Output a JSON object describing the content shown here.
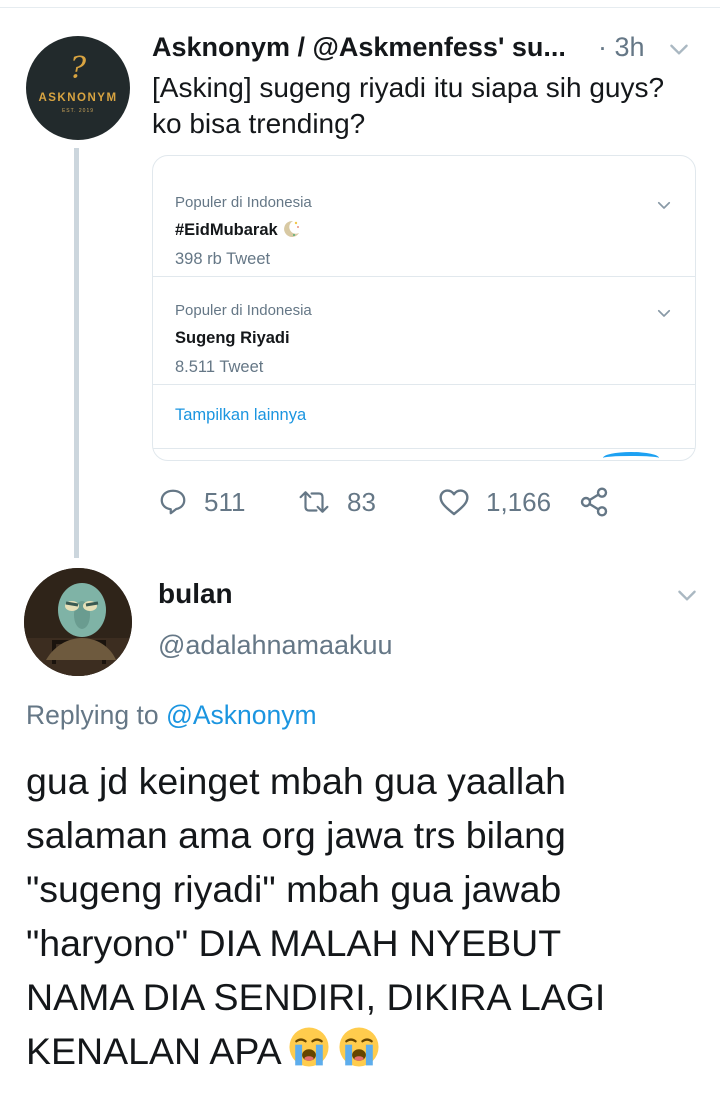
{
  "parent_tweet": {
    "avatar": {
      "brand": "ASKNONYM",
      "est": "EST. 2019",
      "mark": "?"
    },
    "display_name": "Asknonym / @Askmenfess' su...",
    "time": "· 3h",
    "text_lines": [
      "[Asking] sugeng riyadi itu siapa sih guys?",
      "ko bisa trending?"
    ],
    "card": {
      "trends": [
        {
          "location": "Populer di Indonesia",
          "name": "#EidMubarak",
          "emoji": "crescent-moon-emoji",
          "count": "398 rb Tweet"
        },
        {
          "location": "Populer di Indonesia",
          "name": "Sugeng Riyadi",
          "count": "8.511 Tweet"
        }
      ],
      "show_more": "Tampilkan lainnya"
    },
    "actions": {
      "replies": "511",
      "retweets": "83",
      "likes": "1,166"
    }
  },
  "reply_tweet": {
    "display_name": "bulan",
    "handle": "@adalahnamaakuu",
    "replying_prefix": "Replying to",
    "replying_mention": "@Asknonym",
    "body_lines": [
      "gua jd keinget mbah gua yaallah",
      "salaman ama org jawa trs bilang",
      "\"sugeng riyadi\" mbah gua jawab",
      "\"haryono\" DIA MALAH NYEBUT",
      "NAMA DIA SENDIRI, DIKIRA LAGI",
      "KENALAN APA"
    ],
    "body_trailing_emoji": [
      "loudly-crying-face-emoji",
      "loudly-crying-face-emoji"
    ]
  },
  "colors": {
    "text_primary": "#14171a",
    "text_secondary": "#657786",
    "link_blue": "#1b95e0",
    "border": "#e1e8ed",
    "thread_line": "#ccd6dd"
  }
}
